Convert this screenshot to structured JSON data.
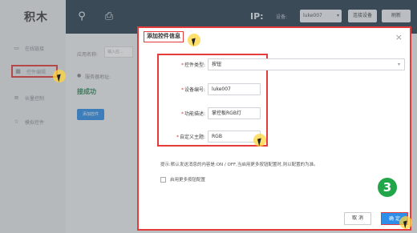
{
  "app": {
    "logo": "积木"
  },
  "sidebar": {
    "items": [
      {
        "label": "在线链接",
        "icon": "monitor-icon"
      },
      {
        "label": "控件编辑",
        "icon": "grid-icon",
        "active": true
      },
      {
        "label": "长量控制",
        "icon": "list-icon"
      },
      {
        "label": "模拟控件",
        "icon": "star-icon"
      }
    ]
  },
  "topbar": {
    "icons": [
      "bulb-icon",
      "puzzle-icon"
    ],
    "ip_label": "IP:",
    "device_label": "设备:",
    "device_value": "luke007",
    "buttons": [
      "连接设备",
      "刷新"
    ]
  },
  "background": {
    "app_name_label": "应用名称:",
    "app_name_placeholder": "输入应...",
    "server_label": "服务器地址:",
    "connected_text": "接成功",
    "add_control_button": "添加控件"
  },
  "modal": {
    "title": "添加控件信息",
    "close": "×",
    "fields": [
      {
        "label": "控件类型:",
        "value": "按钮",
        "type": "select",
        "required": true
      },
      {
        "label": "设备编号:",
        "value": "luke007",
        "type": "input",
        "required": true
      },
      {
        "label": "功能描述:",
        "value": "掌控板RGB灯",
        "type": "input",
        "required": true
      },
      {
        "label": "自定义主题:",
        "value": "RGB",
        "type": "input",
        "required": true
      }
    ],
    "hint": "提示:默认发送消息的内容是:ON / OFF,当启用更多按钮配置时,则以配置的为准。",
    "checkbox_label": "启用更多按钮配置",
    "checkbox_checked": false,
    "cancel_label": "取 消",
    "ok_label": "确 定"
  },
  "step_badge": "3",
  "colors": {
    "highlight": "#e53b3b",
    "primary": "#2e8ee8",
    "step": "#22a64a",
    "topbar": "#2c3f50"
  }
}
